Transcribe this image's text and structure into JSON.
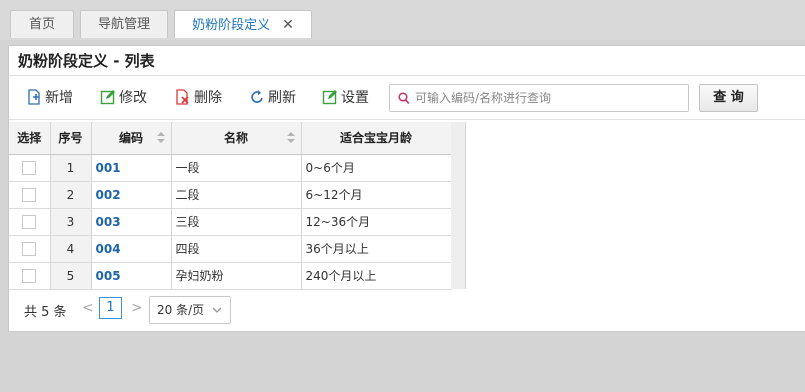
{
  "tabs": [
    {
      "label": "首页"
    },
    {
      "label": "导航管理"
    },
    {
      "label": "奶粉阶段定义",
      "close": "✕"
    }
  ],
  "panel": {
    "title": "奶粉阶段定义 - 列表"
  },
  "toolbar": {
    "add_label": "新增",
    "edit_label": "修改",
    "delete_label": "删除",
    "refresh_label": "刷新",
    "settings_label": "设置",
    "search_placeholder": "可输入编码/名称进行查询",
    "query_label": "查 询"
  },
  "table": {
    "headers": {
      "select": "选择",
      "index": "序号",
      "code": "编码",
      "name": "名称",
      "age": "适合宝宝月龄"
    },
    "rows": [
      {
        "index": "1",
        "code": "001",
        "name": "一段",
        "age": "0~6个月"
      },
      {
        "index": "2",
        "code": "002",
        "name": "二段",
        "age": "6~12个月"
      },
      {
        "index": "3",
        "code": "003",
        "name": "三段",
        "age": "12~36个月"
      },
      {
        "index": "4",
        "code": "004",
        "name": "四段",
        "age": "36个月以上"
      },
      {
        "index": "5",
        "code": "005",
        "name": "孕妇奶粉",
        "age": "240个月以上"
      }
    ]
  },
  "pager": {
    "total": "共 5 条",
    "prev": "<",
    "current_page": "1",
    "next": ">",
    "page_size": "20 条/页"
  },
  "colors": {
    "accent": "#1e74c1",
    "code_text": "#1e65a8",
    "delete_icon": "#d93a3a",
    "edit_icon": "#3aa13a"
  }
}
